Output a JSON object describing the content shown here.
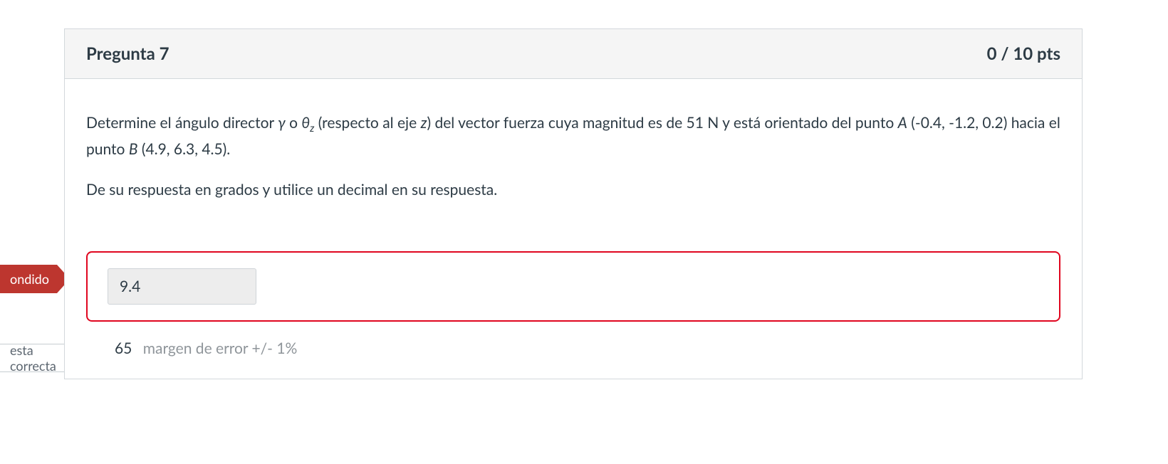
{
  "header": {
    "title": "Pregunta 7",
    "points": "0 / 10 pts"
  },
  "prompt": {
    "line1_pre": "Determine el ángulo director ",
    "gamma": "γ",
    "line1_o": " o ",
    "theta": "θ",
    "theta_sub": "z",
    "line1_mid": "  (respecto al eje ",
    "axis": "z",
    "line1_post": ") del vector fuerza cuya magnitud es de 51 N y está orientado del punto ",
    "pointA_label": "A",
    "pointA_coords": " (-0.4, -1.2, 0.2) hacia el punto ",
    "pointB_label": "B",
    "pointB_coords": " (4.9, 6.3, 4.5).",
    "line2": "De su respuesta en grados y utilice un decimal en su respuesta."
  },
  "answer": {
    "user_value": "9.4"
  },
  "correct": {
    "value": "65",
    "margin_label": "margen de error +/- 1%"
  },
  "tags": {
    "incorrect_partial": "ondido",
    "correct_partial": "esta correcta"
  }
}
